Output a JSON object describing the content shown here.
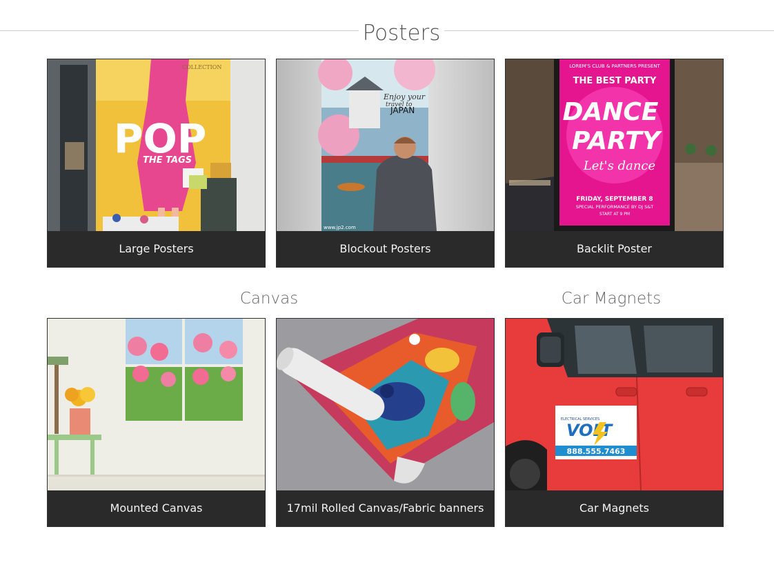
{
  "sections": {
    "posters": {
      "title": "Posters"
    },
    "canvas": {
      "title": "Canvas"
    },
    "car_magnets": {
      "title": "Car Magnets"
    }
  },
  "cards": [
    {
      "caption": "Large Posters",
      "image_text": [
        "POP",
        "THE TAGS",
        "COLLECTION"
      ]
    },
    {
      "caption": "Blockout Posters",
      "image_text": [
        "Enjoy your",
        "travel to",
        "JAPAN",
        "www.jp2.com"
      ]
    },
    {
      "caption": "Backlit Poster",
      "image_text": [
        "LOREM'S CLUB & PARTNERS PRESENT",
        "THE BEST PARTY",
        "DANCE",
        "PARTY",
        "Let's dance",
        "FRIDAY, SEPTEMBER 8",
        "SPECIAL PERFORMANCE BY DJ S&T",
        "START AT 9 PM"
      ]
    },
    {
      "caption": "Mounted Canvas",
      "image_text": []
    },
    {
      "caption": "17mil Rolled Canvas/Fabric banners",
      "image_text": []
    },
    {
      "caption": "Car Magnets",
      "image_text": [
        "ELECTRICAL SERVICES",
        "VOLT",
        "888.555.7463"
      ]
    }
  ],
  "colors": {
    "caption_bg": "#2b2a2a",
    "caption_text": "#f2f2f2",
    "heading": "#555555",
    "rule": "#cfcfcf"
  }
}
